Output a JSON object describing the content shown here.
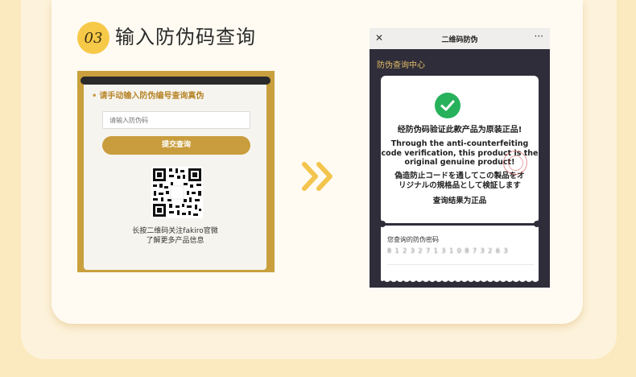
{
  "step": {
    "number": "03",
    "title": "输入防伪码查询"
  },
  "left_panel": {
    "heading": "请手动输入防伪编号查询真伪",
    "input_placeholder": "请输入防伪码",
    "submit_label": "提交查询",
    "qr_icon": "qr-code-icon",
    "caption_line1": "长按二维码关注fakiro官微",
    "caption_line2": "了解更多产品信息"
  },
  "arrow_icon": "double-chevron-right-icon",
  "phone": {
    "title": "二维码防伪",
    "close_glyph": "✕",
    "more_glyph": "···",
    "section_title": "防伪查询中心",
    "result_cn": "经防伪码验证此款产品为原装正品!",
    "result_en_lines": [
      "Through the anti-counterfeiting",
      "code verification, this product is the",
      "original genuine product!"
    ],
    "result_jp_lines": [
      "偽造防止コードを通してこの製品をオ",
      "リジナルの規格品として検証します"
    ],
    "result_summary": "查询结果为正品",
    "code_label": "您查询的防伪密码",
    "code_value": "8 1 2 3 2 7 1 3 1 0 8 7 3 2 6 3"
  },
  "colors": {
    "gold": "#c99d3d",
    "badge_yellow": "#f6c948",
    "phone_bg": "#2f2d3a",
    "success_green": "#27b15b",
    "section_gold": "#e1bd66"
  }
}
